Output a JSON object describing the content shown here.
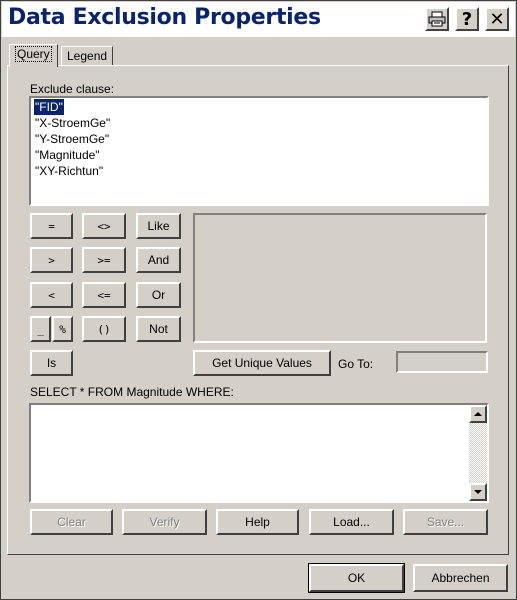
{
  "window": {
    "title": "Data Exclusion Properties",
    "help_label": "?",
    "close_label": "✕"
  },
  "tabs": [
    {
      "label": "Query",
      "active": true
    },
    {
      "label": "Legend",
      "active": false
    }
  ],
  "exclude": {
    "label": "Exclude clause:",
    "fields": [
      "\"FID\"",
      "\"X-StroemGe\"",
      "\"Y-StroemGe\"",
      "\"Magnitude\"",
      "\"XY-Richtun\""
    ],
    "selected_index": 0
  },
  "operators": {
    "eq": "=",
    "ne": "<>",
    "like": "Like",
    "gt": ">",
    "ge": ">=",
    "and": "And",
    "lt": "<",
    "le": "<=",
    "or": "Or",
    "underscore": "_",
    "percent": "%",
    "parens": "()",
    "not": "Not",
    "is": "Is"
  },
  "unique_values": {
    "button_label": "Get Unique Values",
    "goto_label": "Go To:",
    "goto_value": ""
  },
  "sql": {
    "prefix_label": "SELECT * FROM Magnitude WHERE:",
    "text": ""
  },
  "actions": {
    "clear": "Clear",
    "verify": "Verify",
    "help": "Help",
    "load": "Load...",
    "save": "Save..."
  },
  "dialog": {
    "ok": "OK",
    "cancel": "Abbrechen"
  },
  "colors": {
    "face": "#d4d0c8",
    "title_text": "#0a246a",
    "selection": "#0a246a"
  }
}
